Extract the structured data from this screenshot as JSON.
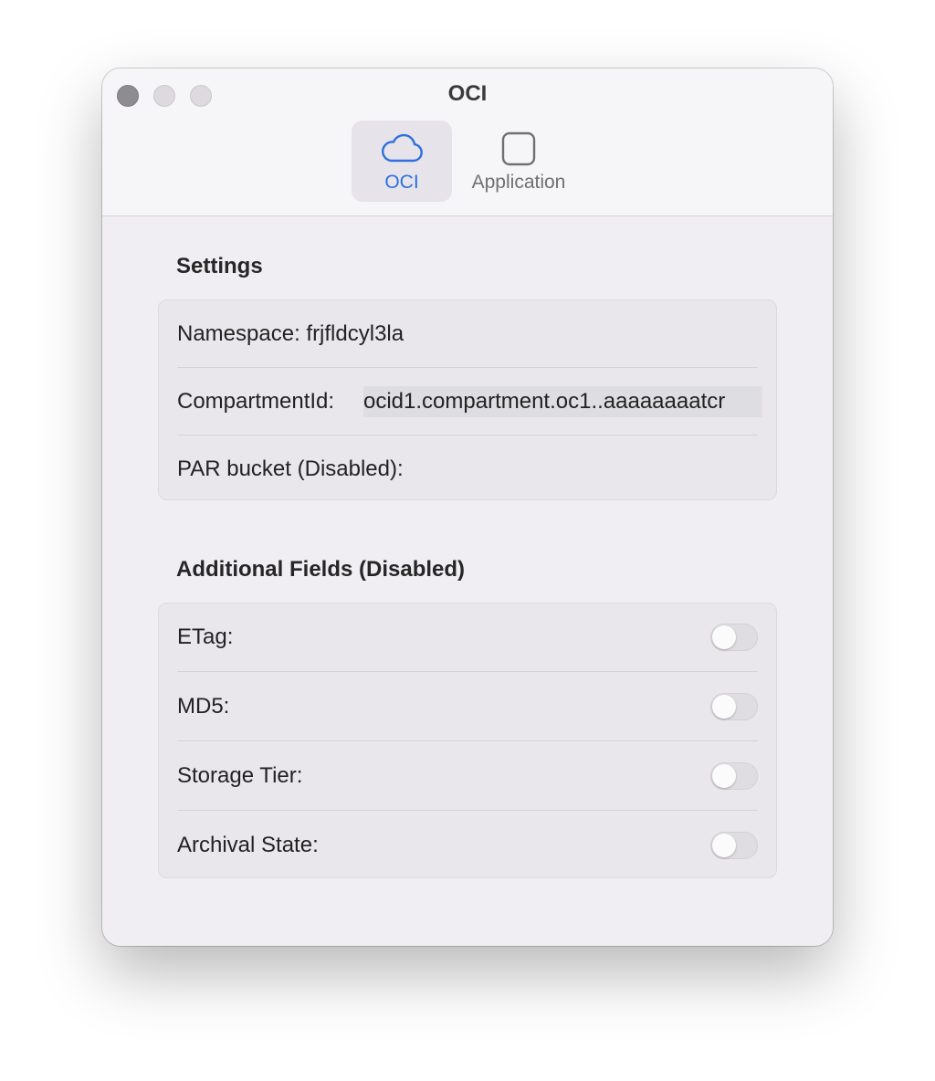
{
  "window": {
    "title": "OCI"
  },
  "toolbar": {
    "tabs": [
      {
        "label": "OCI",
        "icon": "cloud-icon",
        "selected": true
      },
      {
        "label": "Application",
        "icon": "square-icon",
        "selected": false
      }
    ]
  },
  "settings": {
    "title": "Settings",
    "namespace_label": "Namespace: frjfldcyl3la",
    "compartment_label": "CompartmentId:",
    "compartment_value": "ocid1.compartment.oc1..aaaaaaaatcr",
    "par_bucket_label": "PAR bucket (Disabled):"
  },
  "additional_fields": {
    "title": "Additional Fields (Disabled)",
    "items": [
      {
        "label": "ETag:",
        "enabled": false
      },
      {
        "label": "MD5:",
        "enabled": false
      },
      {
        "label": "Storage Tier:",
        "enabled": false
      },
      {
        "label": "Archival State:",
        "enabled": false
      }
    ]
  },
  "colors": {
    "accent": "#2f6fde",
    "window_bg": "#f0eef3",
    "group_bg": "#e9e7ec"
  }
}
